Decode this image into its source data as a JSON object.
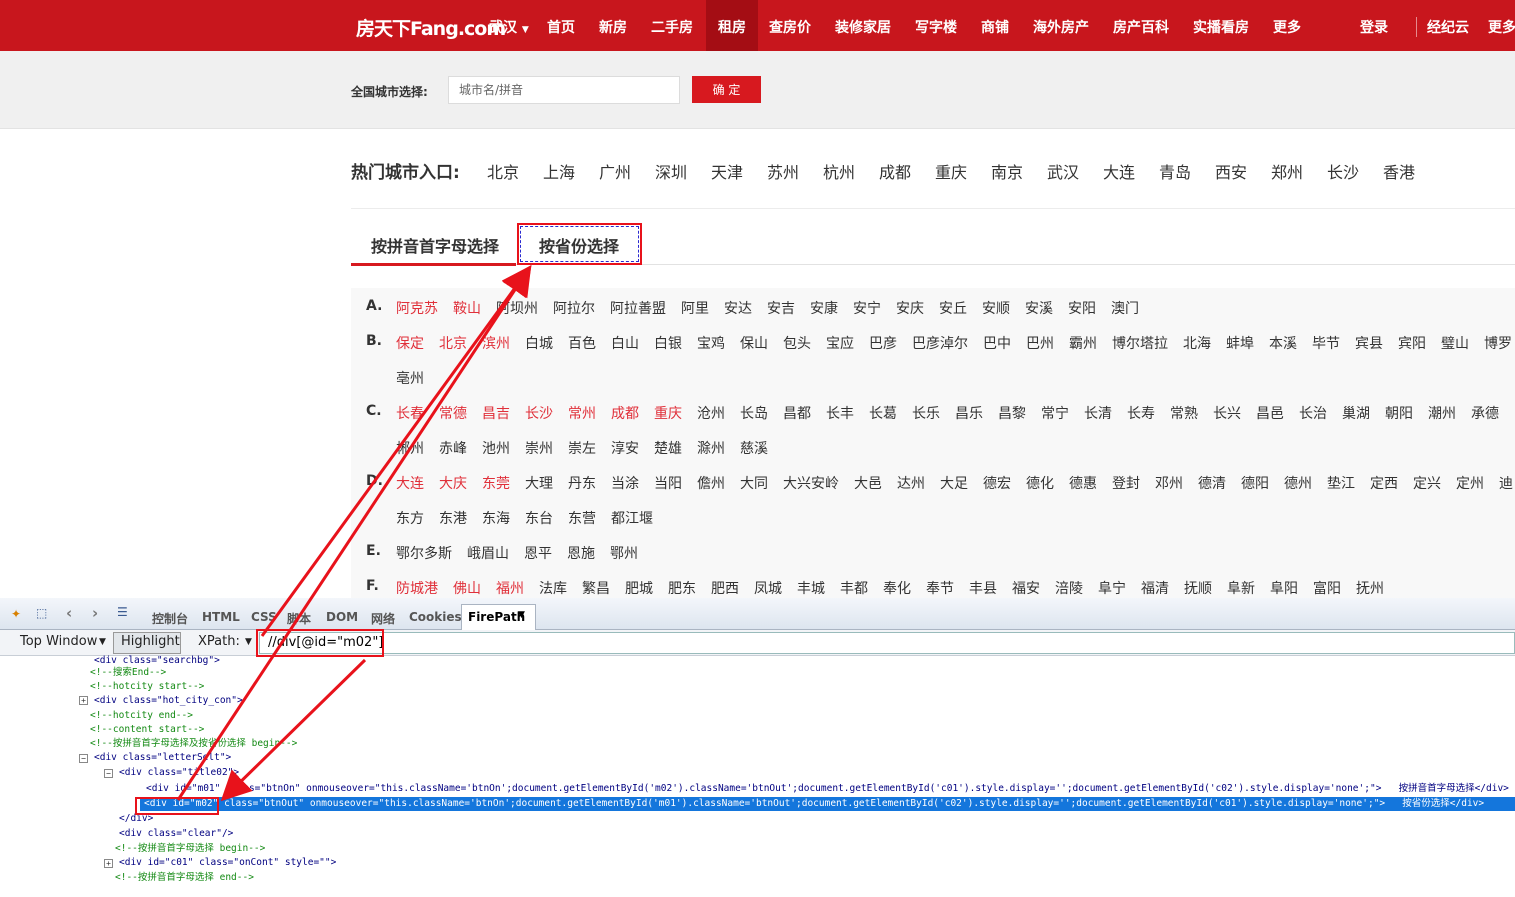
{
  "nav": {
    "logo": "房天下Fang.com",
    "city": "武汉",
    "items": [
      "首页",
      "新房",
      "二手房",
      "租房",
      "查房价",
      "装修家居",
      "写字楼",
      "商铺",
      "海外房产",
      "房产百科",
      "实播看房",
      "更多"
    ],
    "login": "登录",
    "extra": [
      "经纪云",
      "更多"
    ]
  },
  "search": {
    "label": "全国城市选择:",
    "placeholder": "城市名/拼音",
    "button": "确 定"
  },
  "hot": {
    "label": "热门城市入口:",
    "cities": [
      "北京",
      "上海",
      "广州",
      "深圳",
      "天津",
      "苏州",
      "杭州",
      "成都",
      "重庆",
      "南京",
      "武汉",
      "大连",
      "青岛",
      "西安",
      "郑州",
      "长沙",
      "香港"
    ]
  },
  "tabs": {
    "pinyin": "按拼音首字母选择",
    "province": "按省份选择"
  },
  "letters": [
    {
      "letter": "A.",
      "rows": [
        [
          "阿克苏",
          "鞍山",
          "阿坝州",
          "阿拉尔",
          "阿拉善盟",
          "阿里",
          "安达",
          "安吉",
          "安康",
          "安宁",
          "安庆",
          "安丘",
          "安顺",
          "安溪",
          "安阳",
          "澳门"
        ]
      ]
    },
    {
      "letter": "B.",
      "rows": [
        [
          "保定",
          "北京",
          "滨州",
          "白城",
          "百色",
          "白山",
          "白银",
          "宝鸡",
          "保山",
          "包头",
          "宝应",
          "巴彦",
          "巴彦淖尔",
          "巴中",
          "巴州",
          "霸州",
          "博尔塔拉",
          "北海",
          "蚌埠",
          "本溪",
          "毕节",
          "宾县",
          "宾阳",
          "璧山",
          "博罗"
        ],
        [
          "亳州"
        ]
      ]
    },
    {
      "letter": "C.",
      "rows": [
        [
          "长春",
          "常德",
          "昌吉",
          "长沙",
          "常州",
          "成都",
          "重庆",
          "沧州",
          "长岛",
          "昌都",
          "长丰",
          "长葛",
          "长乐",
          "昌乐",
          "昌黎",
          "常宁",
          "长清",
          "长寿",
          "常熟",
          "长兴",
          "昌邑",
          "长治",
          "巢湖",
          "朝阳",
          "潮州",
          "承德"
        ],
        [
          "郴州",
          "赤峰",
          "池州",
          "崇州",
          "崇左",
          "淳安",
          "楚雄",
          "滁州",
          "慈溪"
        ]
      ]
    },
    {
      "letter": "D.",
      "rows": [
        [
          "大连",
          "大庆",
          "东莞",
          "大理",
          "丹东",
          "当涂",
          "当阳",
          "儋州",
          "大同",
          "大兴安岭",
          "大邑",
          "达州",
          "大足",
          "德宏",
          "德化",
          "德惠",
          "登封",
          "邓州",
          "德清",
          "德阳",
          "德州",
          "垫江",
          "定西",
          "定兴",
          "定州",
          "迪"
        ],
        [
          "东方",
          "东港",
          "东海",
          "东台",
          "东营",
          "都江堰"
        ]
      ]
    },
    {
      "letter": "E.",
      "rows": [
        [
          "鄂尔多斯",
          "峨眉山",
          "恩平",
          "恩施",
          "鄂州"
        ]
      ]
    },
    {
      "letter": "F.",
      "rows": [
        [
          "防城港",
          "佛山",
          "福州",
          "法库",
          "繁昌",
          "肥城",
          "肥东",
          "肥西",
          "凤城",
          "丰城",
          "丰都",
          "奉化",
          "奉节",
          "丰县",
          "福安",
          "涪陵",
          "阜宁",
          "福清",
          "抚顺",
          "阜新",
          "阜阳",
          "富阳",
          "抚州"
        ]
      ]
    }
  ],
  "firebug": {
    "tabs": [
      "控制台",
      "HTML",
      "CSS",
      "脚本",
      "DOM",
      "网络",
      "Cookies",
      "FirePath"
    ],
    "window": "Top Window",
    "highlight": "Highlight",
    "xpath_label": "XPath:",
    "xpath_value": "//div[@id=\"m02\"]",
    "code": [
      "<div class=\"searchbg\">",
      "<!--搜索End-->",
      "<!--hotcity start-->",
      "<div class=\"hot_city_con\">",
      "<!--hotcity end-->",
      "<!--content start-->",
      "<!--按拼音首字母选择及按省份选择 begin-->",
      "<div class=\"letterSelt\">",
      "<div class=\"title02\">",
      "<div id=\"m01\" class=\"btnOn\" onmouseover=\"this.className='btnOn';document.getElementById('m02').className='btnOut';document.getElementById('c01').style.display='';document.getElementById('c02').style.display='none';\">   按拼音首字母选择</div>",
      "<div id=\"m02\" class=\"btnOut\" onmouseover=\"this.className='btnOn';document.getElementById('m01').className='btnOut';document.getElementById('c02').style.display='';document.getElementById('c01').style.display='none';\">   按省份选择</div>",
      "</div>",
      "<div class=\"clear\"/>",
      "<!--按拼音首字母选择 begin-->",
      "<div id=\"c01\" class=\"onCont\" style=\"\">",
      "<!--按拼音首字母选择 end-->"
    ]
  },
  "colors": {
    "brand": "#c8161d",
    "highlight_red": "#e0303a",
    "selection": "#1476dc"
  }
}
